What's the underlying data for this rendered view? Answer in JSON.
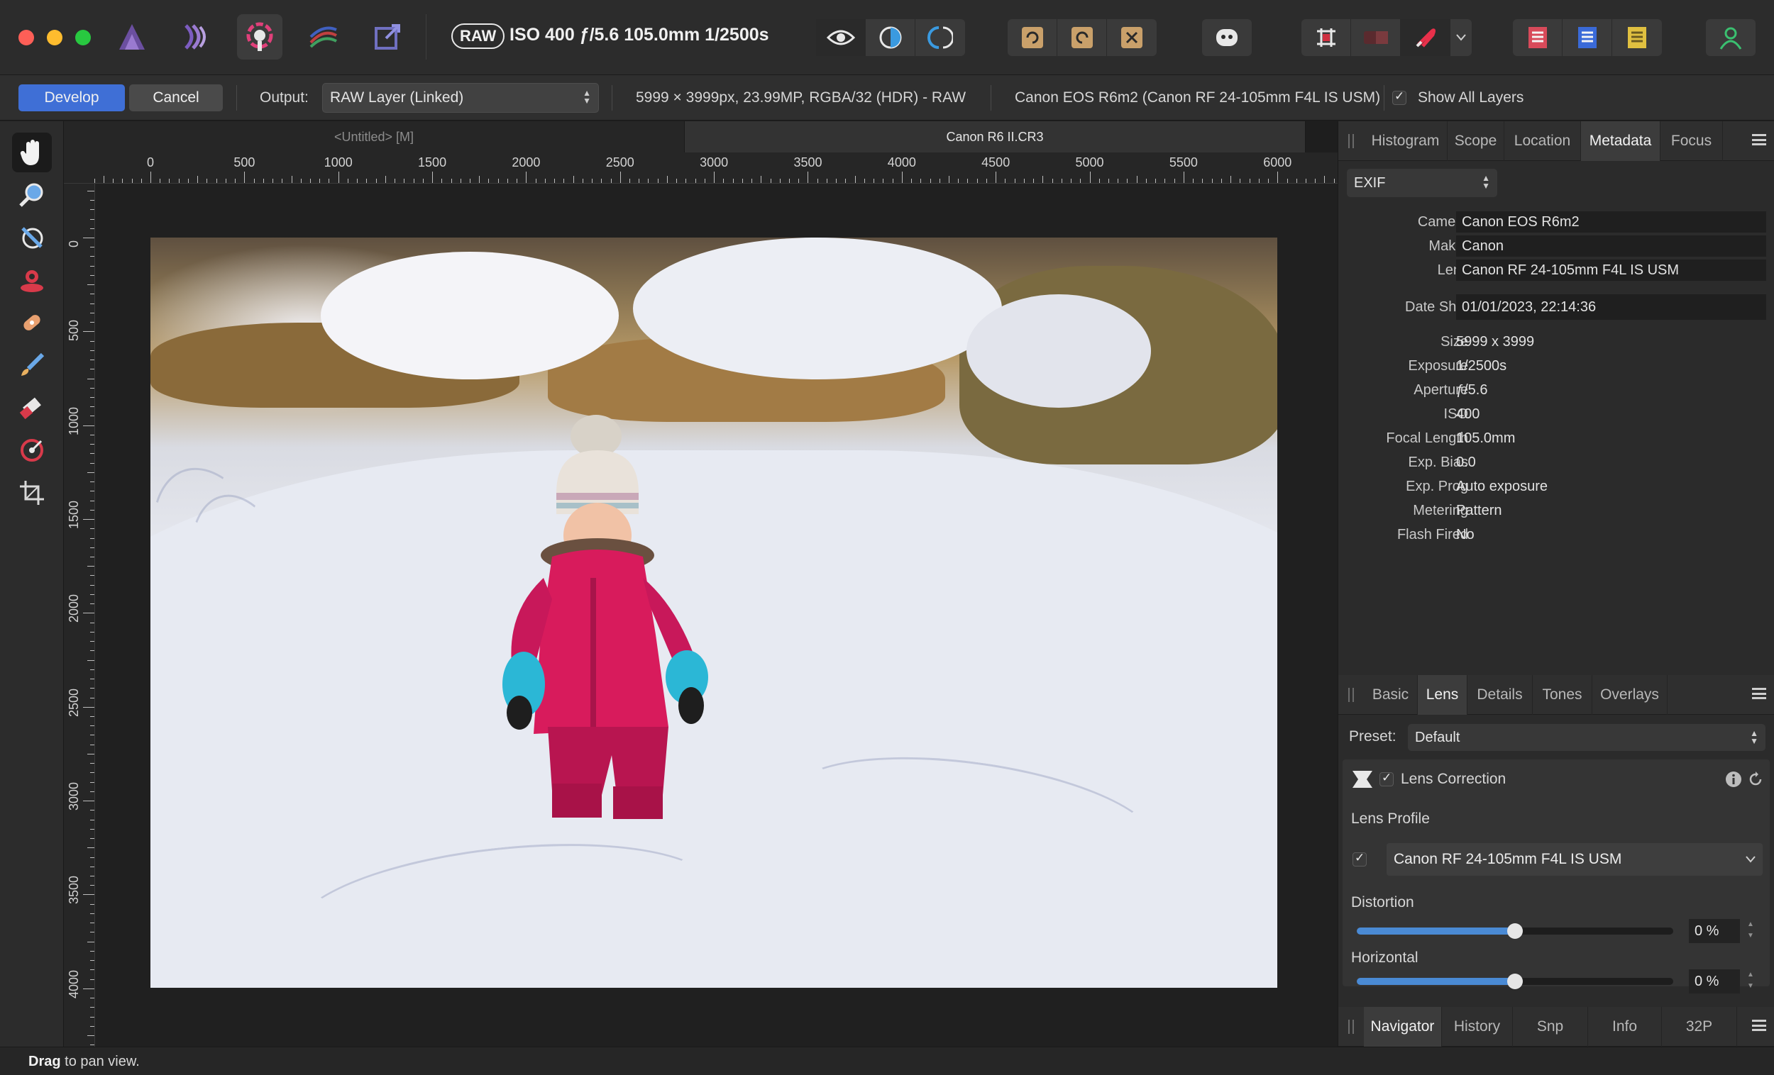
{
  "titlebar": {
    "raw_badge": "RAW",
    "exif_summary": "ISO 400 ƒ/5.6 105.0mm 1/2500s"
  },
  "contextbar": {
    "develop_label": "Develop",
    "cancel_label": "Cancel",
    "output_label": "Output:",
    "output_value": "RAW Layer (Linked)",
    "image_info": "5999 × 3999px, 23.99MP, RGBA/32 (HDR) - RAW",
    "camera_info": "Canon EOS R6m2 (Canon RF 24-105mm F4L IS USM)",
    "show_all_layers_label": "Show All Layers",
    "show_all_layers_checked": true
  },
  "doc_tabs": [
    {
      "label": "<Untitled> [M]"
    },
    {
      "label": "Canon R6 II.CR3"
    }
  ],
  "ruler": {
    "unit": "px",
    "h_labels": [
      "0",
      "500",
      "1000",
      "1500",
      "2000",
      "2500",
      "3000",
      "3500",
      "4000",
      "4500",
      "5000",
      "5500",
      "6000"
    ],
    "v_labels": [
      "0",
      "500",
      "1000",
      "1500",
      "2000",
      "2500",
      "3000",
      "3500",
      "4000"
    ]
  },
  "top_panel": {
    "tabs": [
      "Histogram",
      "Scope",
      "Location",
      "Metadata",
      "Focus"
    ],
    "active_tab": "Metadata",
    "exif_select": "EXIF",
    "metadata": {
      "camera": {
        "label": "Camera",
        "value": "Canon EOS R6m2"
      },
      "maker": {
        "label": "Maker",
        "value": "Canon"
      },
      "lens": {
        "label": "Lens",
        "value": "Canon RF 24-105mm F4L IS USM"
      },
      "date_shot": {
        "label": "Date Shot",
        "value": "01/01/2023, 22:14:36"
      },
      "size": {
        "label": "Size",
        "value": "5999 x 3999"
      },
      "exposure": {
        "label": "Exposure",
        "value": "1/2500s"
      },
      "aperture": {
        "label": "Aperture",
        "value": "ƒ/5.6"
      },
      "iso": {
        "label": "ISO",
        "value": "400"
      },
      "focal_length": {
        "label": "Focal Length",
        "value": "105.0mm"
      },
      "exp_bias": {
        "label": "Exp. Bias",
        "value": "0.0"
      },
      "exp_prog": {
        "label": "Exp. Prog",
        "value": "Auto exposure"
      },
      "metering": {
        "label": "Metering",
        "value": "Pattern"
      },
      "flash_fired": {
        "label": "Flash Fired",
        "value": "No"
      }
    }
  },
  "mid_panel": {
    "tabs": [
      "Basic",
      "Lens",
      "Details",
      "Tones",
      "Overlays"
    ],
    "active_tab": "Lens",
    "preset_label": "Preset:",
    "preset_value": "Default",
    "lens_correction_label": "Lens Correction",
    "lens_profile_label": "Lens Profile",
    "lens_profile_value": "Canon RF 24-105mm F4L IS USM",
    "distortion_label": "Distortion",
    "distortion_value": "0 %",
    "distortion_level": 0.5,
    "horizontal_label": "Horizontal",
    "horizontal_value": "0 %",
    "horizontal_level": 0.5
  },
  "bottom_panel": {
    "tabs": [
      "Navigator",
      "History",
      "Snp",
      "Info",
      "32P"
    ],
    "active_tab": "Navigator"
  },
  "statusbar": {
    "action": "Drag",
    "hint": " to pan view."
  },
  "colors": {
    "accent": "#3f6fd6",
    "slider_fill": "#4a8ad4",
    "jacket": "#d81b5c",
    "mittens": "#2bb7d6"
  },
  "icons": {
    "tools": [
      "hand-icon",
      "zoom-icon",
      "white-balance-icon",
      "red-eye-icon",
      "blemish-icon",
      "overlay-paint-icon",
      "overlay-erase-icon",
      "overlay-gradient-icon",
      "crop-icon"
    ]
  }
}
